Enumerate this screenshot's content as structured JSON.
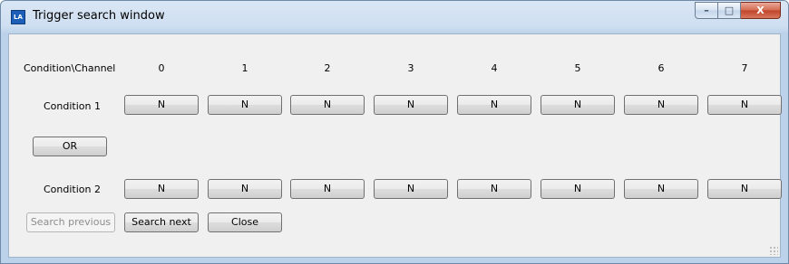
{
  "window": {
    "title": "Trigger search window",
    "app_icon_text": "LA"
  },
  "header": {
    "corner_label": "Condition\\Channel",
    "channels": [
      "0",
      "1",
      "2",
      "3",
      "4",
      "5",
      "6",
      "7"
    ]
  },
  "conditions": [
    {
      "label": "Condition 1",
      "values": [
        "N",
        "N",
        "N",
        "N",
        "N",
        "N",
        "N",
        "N"
      ]
    },
    {
      "label": "Condition 2",
      "values": [
        "N",
        "N",
        "N",
        "N",
        "N",
        "N",
        "N",
        "N"
      ]
    }
  ],
  "logic_button": "OR",
  "actions": {
    "search_previous": "Search previous",
    "search_next": "Search next",
    "close": "Close"
  },
  "caption_buttons": {
    "minimize": "–",
    "maximize": "□",
    "close": "X"
  }
}
